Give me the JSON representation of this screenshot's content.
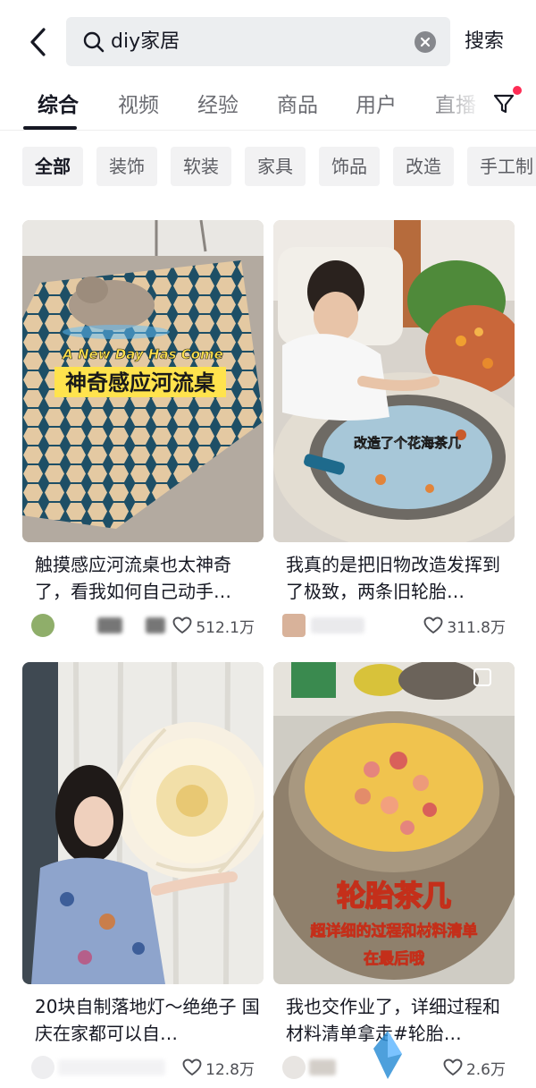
{
  "search": {
    "query": "diy家居",
    "submit_label": "搜索"
  },
  "tabs": [
    {
      "label": "综合",
      "active": true
    },
    {
      "label": "视频",
      "active": false
    },
    {
      "label": "经验",
      "active": false
    },
    {
      "label": "商品",
      "active": false
    },
    {
      "label": "用户",
      "active": false
    },
    {
      "label": "直播",
      "active": false
    }
  ],
  "chips": [
    {
      "label": "全部",
      "active": true
    },
    {
      "label": "装饰"
    },
    {
      "label": "软装"
    },
    {
      "label": "家具"
    },
    {
      "label": "饰品"
    },
    {
      "label": "改造"
    },
    {
      "label": "手工制"
    }
  ],
  "cards": [
    {
      "overlay_en": "A New Day Has Come",
      "overlay_cn": "神奇感应河流桌",
      "title": "触摸感应河流桌也太神奇了，看我如何自己动手…",
      "likes": "512.1万"
    },
    {
      "overlay_cn": "改造了个花海茶几",
      "title": "我真的是把旧物改造发挥到了极致，两条旧轮胎…",
      "likes": "311.8万"
    },
    {
      "title": "20块自制落地灯～绝绝子 国庆在家都可以自…",
      "likes": "12.8万"
    },
    {
      "overlay_big": "轮胎茶几",
      "overlay_sub1": "超详细的过程和材料清单",
      "overlay_sub2": "在最后哦",
      "title": "我也交作业了，详细过程和材料清单拿走#轮胎…",
      "likes": "2.6万"
    }
  ],
  "colors": {
    "accent_red": "#fe2c55",
    "text_primary": "#161823",
    "overlay_yellow": "#ffe34d"
  }
}
